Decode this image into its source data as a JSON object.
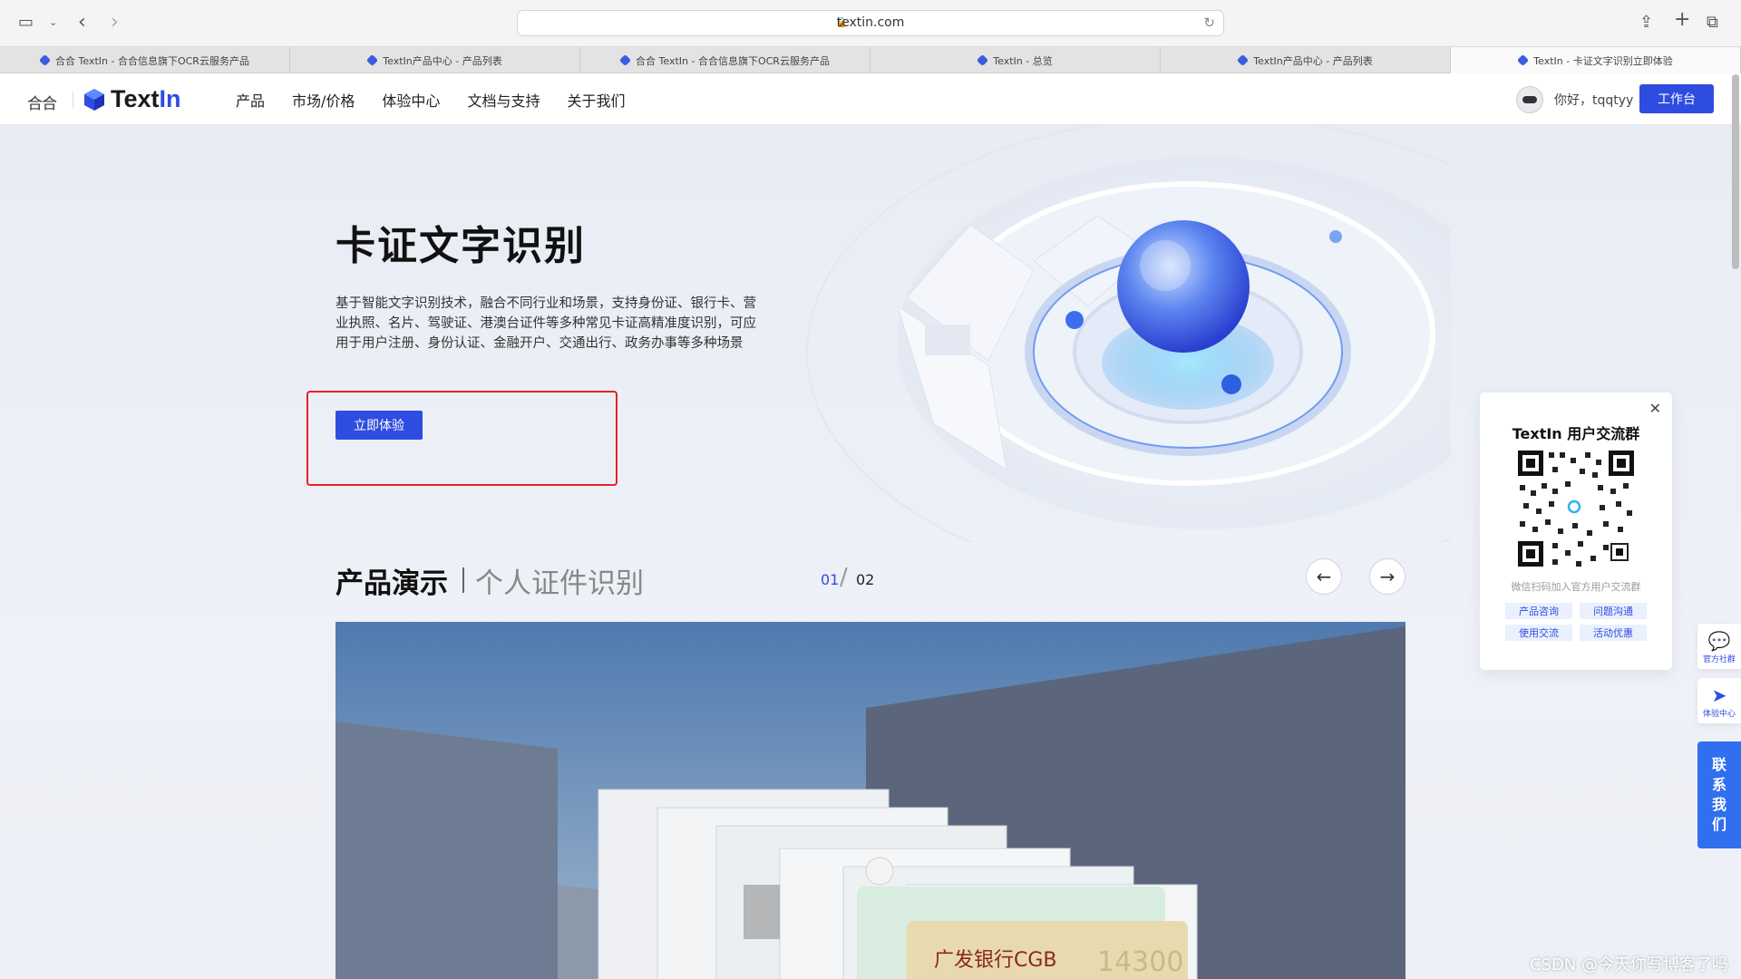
{
  "browser": {
    "url": "textin.com",
    "tabs": [
      {
        "label": "合合 TextIn - 合合信息旗下OCR云服务产品",
        "active": false
      },
      {
        "label": "TextIn产品中心 - 产品列表",
        "active": false
      },
      {
        "label": "合合 TextIn - 合合信息旗下OCR云服务产品",
        "active": false
      },
      {
        "label": "TextIn - 总览",
        "active": false
      },
      {
        "label": "TextIn产品中心 - 产品列表",
        "active": false
      },
      {
        "label": "TextIn - 卡证文字识别立即体验",
        "active": true
      }
    ]
  },
  "header": {
    "brand_mark": "合合",
    "brand_text": "Text",
    "brand_text_accent": "In",
    "nav": [
      "产品",
      "市场/价格",
      "体验中心",
      "文档与支持",
      "关于我们"
    ],
    "greeting": "你好，tqqtyy",
    "workbench_label": "工作台"
  },
  "hero": {
    "title": "卡证文字识别",
    "description": "基于智能文字识别技术，融合不同行业和场景，支持身份证、银行卡、营业执照、名片、驾驶证、港澳台证件等多种常见卡证高精准度识别，可应用于用户注册、身份认证、金融开户、交通出行、政务办事等多种场景",
    "try_label": "立即体验"
  },
  "demo": {
    "title": "产品演示",
    "subtitle": "个人证件识别",
    "page_current": "01",
    "page_slash": "/",
    "page_total": "02",
    "card_text": "广发银行CGB",
    "card_number": "14300"
  },
  "qr_popup": {
    "title": "TextIn 用户交流群",
    "note": "微信扫码加入官方用户交流群",
    "tags": [
      "产品咨询",
      "问题沟通",
      "使用交流",
      "活动优惠"
    ]
  },
  "float": {
    "community_label": "官方社群",
    "experience_label": "体验中心",
    "contact_chars": [
      "联",
      "系",
      "我",
      "们"
    ]
  },
  "watermark": "CSDN @今天你写博客了吗",
  "colors": {
    "accent": "#2f4ce0",
    "highlight": "#e8202a"
  }
}
